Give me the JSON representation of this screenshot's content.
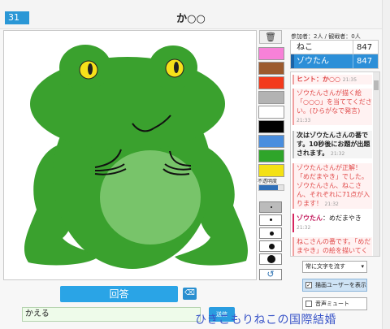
{
  "header": {
    "room_number": "31",
    "title": "か○○"
  },
  "tools": {
    "trash_icon": "trash-icon",
    "colors": [
      "#f781d8",
      "#9c5a2e",
      "#f33a1c",
      "#b3b3b3",
      "#ffffff",
      "#000000",
      "#4a8ede",
      "#2fa52a",
      "#f4e114",
      "#f7920a"
    ],
    "opacity_label": "不透明度",
    "opacity_value": 0.75,
    "undo_icon": "undo-icon"
  },
  "answer": {
    "submit_label": "回答",
    "clear_icon": "backspace-icon",
    "input_value": "かえる",
    "send_label": "送信"
  },
  "side": {
    "counts": "参加者：2人 / 観戦者：0人",
    "players": [
      {
        "name": "ねこ",
        "score": "847",
        "drawing": false
      },
      {
        "name": "ゾウたん",
        "score": "847",
        "drawing": true
      }
    ],
    "chat": [
      {
        "kind": "system",
        "text": "ヒント：か○○",
        "time": "21:35"
      },
      {
        "kind": "system",
        "text": "ゾウたんさんが描く絵「○○○」を当ててください。(ひらがなで発言)",
        "time": "21:33"
      },
      {
        "kind": "notice",
        "text": "次はゾウたんさんの番です。10秒後にお題が出題されます。",
        "time": "21:32"
      },
      {
        "kind": "system",
        "text": "ゾウたんさんが正解！「めだまやき」でした。ゾウたんさん、ねこさん、それぞれに71点が入ります！",
        "time": "21:32"
      },
      {
        "kind": "user",
        "speaker": "ゾウたん",
        "text": "：めだまやき",
        "time": "21:32"
      },
      {
        "kind": "system",
        "text": "ねこさんの番です。「めだまやき」の絵を描いてくだ",
        "time": ""
      }
    ],
    "flow_select": "常に文字を流す",
    "toggle_drawer": "描画ユーザーを表示",
    "toggle_mute": "音声ミュート"
  },
  "watermark": "ひきこもりねこの国際結婚"
}
